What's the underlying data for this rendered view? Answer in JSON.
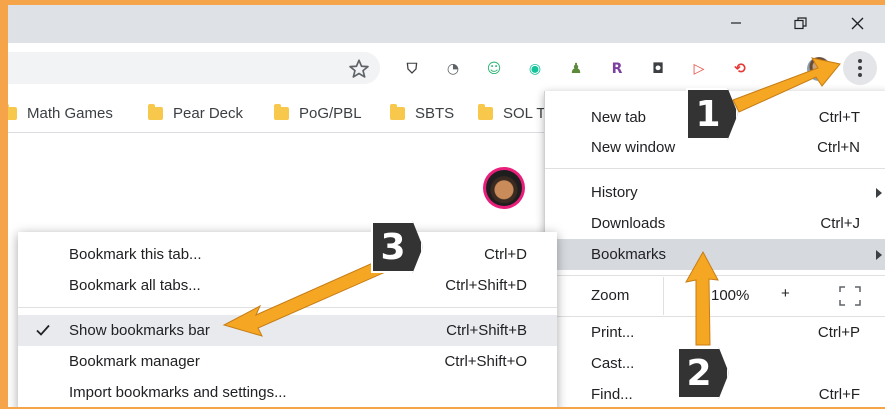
{
  "window": {
    "minimize_glyph": "—",
    "restore_glyph": "❐",
    "close_glyph": "✕"
  },
  "toolbar": {
    "extensions": [
      {
        "icon": "pocket-icon",
        "glyph": "⛉",
        "color": "#3c4043"
      },
      {
        "icon": "grammar-icon",
        "glyph": "◔",
        "color": "#5f6368"
      },
      {
        "icon": "bitmoji-icon",
        "glyph": "☺",
        "color": "#2bb673"
      },
      {
        "icon": "grammarly-icon",
        "glyph": "◉",
        "color": "#15c39a"
      },
      {
        "icon": "pear-deck-icon",
        "glyph": "♟",
        "color": "#5b8a3a"
      },
      {
        "icon": "rewordify-icon",
        "glyph": "R",
        "color": "#7b3fa0"
      },
      {
        "icon": "lightbulb-icon",
        "glyph": "◘",
        "color": "#3c4043"
      },
      {
        "icon": "screencast-icon",
        "glyph": "▷",
        "color": "#e8453c"
      },
      {
        "icon": "lastpass-icon",
        "glyph": "⟲",
        "color": "#e53935"
      }
    ]
  },
  "bookmarks_bar": {
    "items": [
      {
        "label": "Math Games"
      },
      {
        "label": "Pear Deck"
      },
      {
        "label": "PoG/PBL"
      },
      {
        "label": "SBTS"
      },
      {
        "label": "SOL T"
      }
    ]
  },
  "chrome_menu": {
    "new_tab": {
      "label": "New tab",
      "shortcut": "Ctrl+T"
    },
    "new_window": {
      "label": "New window",
      "shortcut": "Ctrl+N"
    },
    "history": {
      "label": "History"
    },
    "downloads": {
      "label": "Downloads",
      "shortcut": "Ctrl+J"
    },
    "bookmarks": {
      "label": "Bookmarks"
    },
    "zoom": {
      "label": "Zoom",
      "value": "100%",
      "plus": "+"
    },
    "print": {
      "label": "Print...",
      "shortcut": "Ctrl+P"
    },
    "cast": {
      "label": "Cast..."
    },
    "find": {
      "label": "Find...",
      "shortcut": "Ctrl+F"
    }
  },
  "bookmarks_submenu": {
    "bookmark_tab": {
      "label": "Bookmark this tab...",
      "shortcut": "Ctrl+D"
    },
    "bookmark_all": {
      "label": "Bookmark all tabs...",
      "shortcut": "Ctrl+Shift+D"
    },
    "show_bar": {
      "label": "Show bookmarks bar",
      "shortcut": "Ctrl+Shift+B",
      "checked": true
    },
    "manager": {
      "label": "Bookmark manager",
      "shortcut": "Ctrl+Shift+O"
    },
    "import": {
      "label": "Import bookmarks and settings..."
    }
  },
  "callouts": {
    "step1": "1",
    "step2": "2",
    "step3": "3",
    "arrow_color": "#f5a623"
  },
  "colors": {
    "border": "#f5a44a",
    "titlebar": "#dee1e6",
    "highlight": "#d6d9de"
  }
}
